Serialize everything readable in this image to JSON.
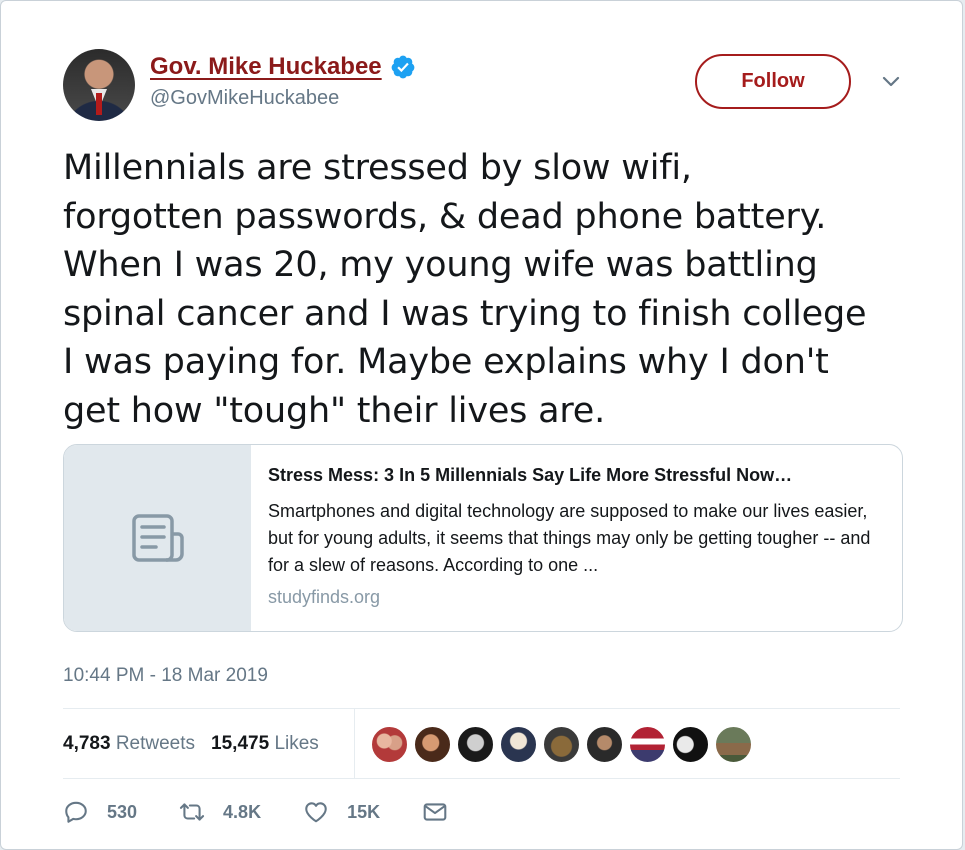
{
  "author": {
    "name": "Gov. Mike Huckabee",
    "handle": "@GovMikeHuckabee",
    "verified": true
  },
  "follow_label": "Follow",
  "tweet": {
    "text": "Millennials are stressed by slow wifi,\nforgotten passwords, & dead phone battery.\nWhen I was 20, my young wife was battling\nspinal cancer and I was trying to finish college\nI was paying for.  Maybe explains why I don't\nget how \"tough\" their lives are."
  },
  "card": {
    "title": "Stress Mess: 3 In 5 Millennials Say Life More Stressful Now…",
    "description": "Smartphones and digital technology are supposed to make our lives easier, but for young adults, it seems that things may only be getting tougher -- and for a slew of reasons. According to one ...",
    "domain": "studyfinds.org"
  },
  "timestamp": "10:44 PM - 18 Mar 2019",
  "stats": {
    "retweets_count": "4,783",
    "retweets_label": "Retweets",
    "likes_count": "15,475",
    "likes_label": "Likes"
  },
  "actions": {
    "replies": "530",
    "retweets": "4.8K",
    "likes": "15K"
  },
  "colors": {
    "brand_red": "#8b1a1a",
    "verified_blue": "#1da1f2",
    "muted": "#657786"
  },
  "icons": [
    "verified-icon",
    "chevron-down-icon",
    "article-icon",
    "reply-icon",
    "retweet-icon",
    "like-icon",
    "dm-icon"
  ]
}
